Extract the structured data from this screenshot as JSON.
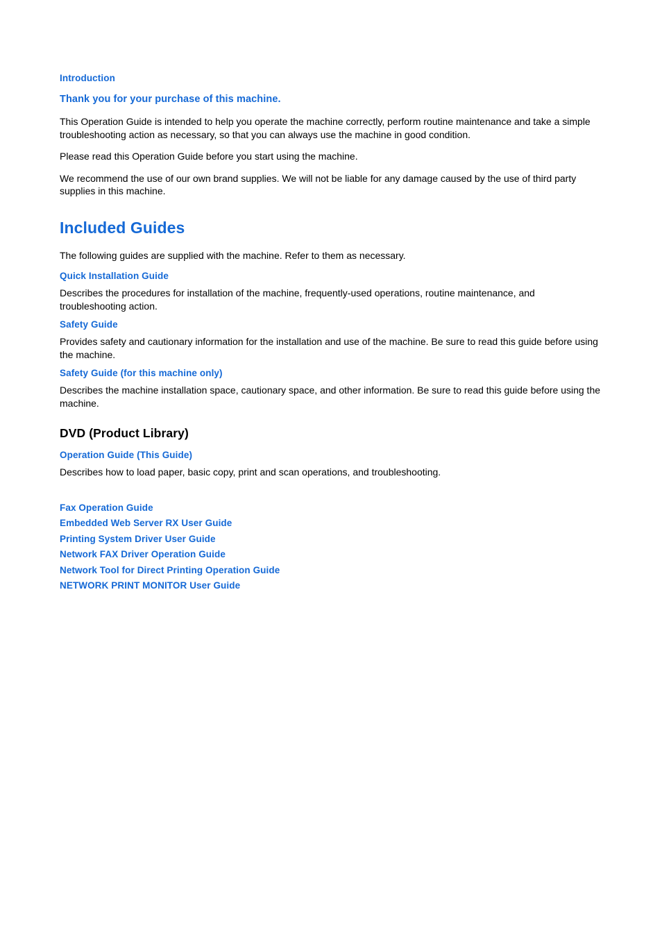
{
  "colors": {
    "heading_blue": "#1569d6",
    "body_black": "#000000",
    "page_background": "#ffffff"
  },
  "intro": {
    "section_heading": "Introduction",
    "lead_heading": "Thank you for your purchase of this machine.",
    "paragraphs": [
      "This Operation Guide is intended to help you operate the machine correctly, perform routine maintenance and take a simple troubleshooting action as necessary, so that you can always use the machine in good condition.",
      "Please read this Operation Guide before you start using the machine.",
      "We recommend the use of our own brand supplies. We will not be liable for any damage caused by the use of third party supplies in this machine."
    ]
  },
  "included_guides": {
    "heading": "Included Guides",
    "intro_text": "The following guides are supplied with the machine. Refer to them as necessary.",
    "guides": [
      {
        "title": "Quick Installation Guide",
        "description": "Describes the procedures for installation of the machine, frequently-used operations, routine maintenance, and troubleshooting action."
      },
      {
        "title": "Safety Guide",
        "description": "Provides safety and cautionary information for the installation and use of the machine. Be sure to read this guide before using the machine."
      },
      {
        "title": "Safety Guide (for this machine only)",
        "description": "Describes the machine installation space, cautionary space, and other information. Be sure to read this guide before using the machine."
      }
    ]
  },
  "dvd": {
    "heading": "DVD (Product Library)",
    "primary_guide": {
      "title": "Operation Guide (This Guide)",
      "description": "Describes how to load paper, basic copy, print and scan operations, and troubleshooting."
    },
    "other_guides": [
      "Fax Operation Guide",
      "Embedded Web Server RX User Guide",
      "Printing System Driver User Guide",
      "Network FAX Driver Operation Guide",
      "Network Tool for Direct Printing Operation Guide",
      "NETWORK PRINT MONITOR User Guide"
    ]
  }
}
